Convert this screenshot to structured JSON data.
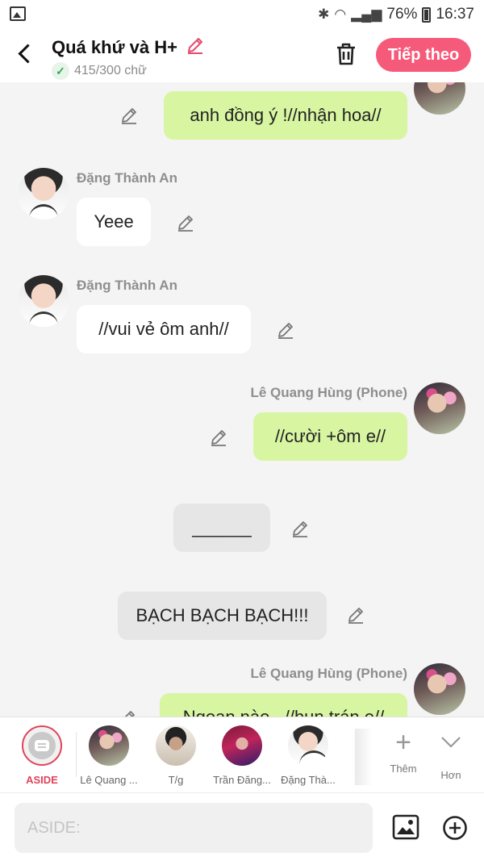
{
  "status_bar": {
    "battery": "76%",
    "time": "16:37"
  },
  "header": {
    "title": "Quá khứ và H+",
    "word_count": "415/300 chữ",
    "next_label": "Tiếp theo"
  },
  "messages": [
    {
      "side": "right",
      "speaker": "",
      "text": "anh đồng ý  !//nhận hoa//"
    },
    {
      "side": "left",
      "speaker": "Đặng Thành An",
      "text": "Yeee"
    },
    {
      "side": "left",
      "speaker": "Đặng Thành An",
      "text": "//vui vẻ ôm anh//"
    },
    {
      "side": "right",
      "speaker": "Lê Quang Hùng (Phone)",
      "text": "//cười +ôm e//"
    },
    {
      "side": "center",
      "speaker": "",
      "text": "______"
    },
    {
      "side": "center",
      "speaker": "",
      "text": "BẠCH BẠCH BẠCH!!!"
    },
    {
      "side": "right",
      "speaker": "Lê Quang Hùng (Phone)",
      "text": "Ngoan nào...//hun trán e//"
    }
  ],
  "characters": {
    "aside_label": "ASIDE",
    "items": [
      {
        "label": "Lê Quang ..."
      },
      {
        "label": "T/g"
      },
      {
        "label": "Trần Đăng..."
      },
      {
        "label": "Đặng Thà..."
      }
    ],
    "add_label": "Thêm",
    "more_label": "Hơn"
  },
  "composer": {
    "placeholder": "ASIDE:",
    "value": ""
  },
  "colors": {
    "accent": "#f65a7a",
    "aside_red": "#e0435a",
    "green_bubble": "#d8f5a2"
  },
  "icons": {
    "back": "chevron-left-icon",
    "trash": "trash-icon",
    "edit": "pencil-icon",
    "image": "image-icon",
    "add": "plus-circle-icon"
  }
}
